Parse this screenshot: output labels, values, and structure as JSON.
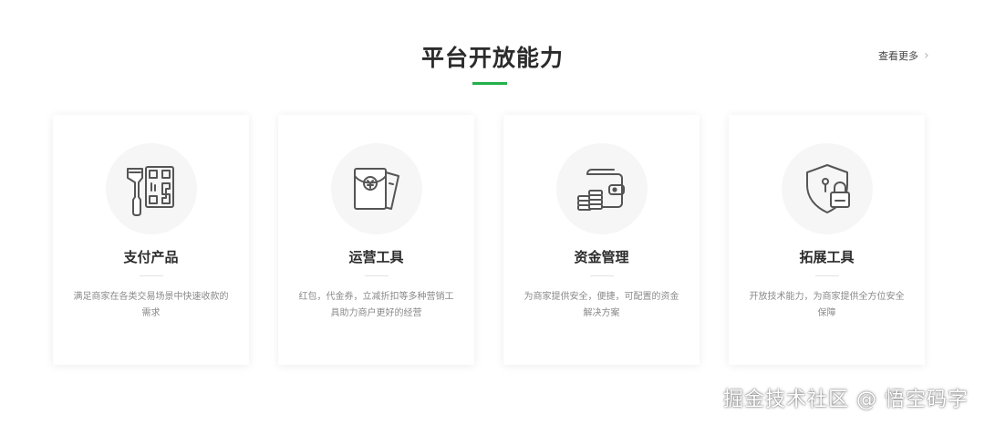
{
  "section": {
    "title": "平台开放能力",
    "see_more": "查看更多",
    "accent": "#22b04b"
  },
  "cards": [
    {
      "icon": "barcode-scanner-icon",
      "title": "支付产品",
      "desc": "满足商家在各类交易场景中快速收款的需求"
    },
    {
      "icon": "red-envelope-coupon-icon",
      "title": "运营工具",
      "desc": "红包，代金券，立减折扣等多种营销工具助力商户更好的经营"
    },
    {
      "icon": "wallet-coins-icon",
      "title": "资金管理",
      "desc": "为商家提供安全，便捷，可配置的资金解决方案"
    },
    {
      "icon": "shield-lock-icon",
      "title": "拓展工具",
      "desc": "开放技术能力，为商家提供全方位安全保障"
    }
  ],
  "watermark": "掘金技术社区 @ 悟空码字"
}
